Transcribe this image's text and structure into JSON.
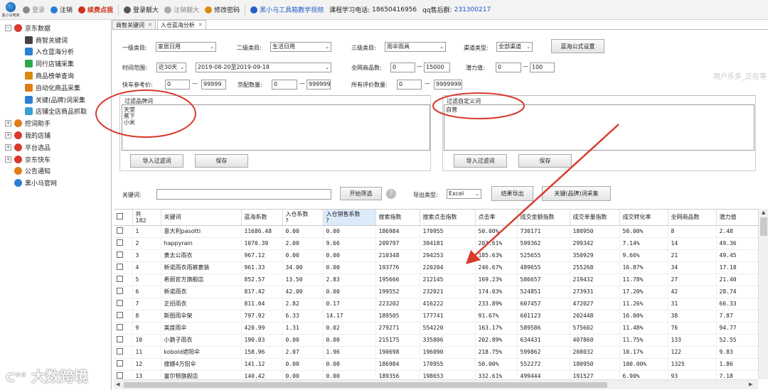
{
  "toolbar": {
    "logo_caption": "黑小马电商",
    "items": [
      {
        "label": "登录",
        "icon": "user-icon",
        "color": "#8a8a8a",
        "dim": true
      },
      {
        "label": "注销",
        "icon": "power-icon",
        "color": "#2a7fd4"
      },
      {
        "label": "续费点我",
        "icon": "ribbon-icon",
        "color": "#d0301a",
        "red": true
      },
      {
        "label": "登录靓大",
        "icon": "login-icon",
        "color": "#555"
      },
      {
        "label": "注销靓大",
        "icon": "power-icon",
        "color": "#aaa",
        "dim": true
      },
      {
        "label": "修改密码",
        "icon": "key-icon",
        "color": "#e08a10"
      },
      {
        "label": "黑小马工具箱教学视频",
        "icon": "video-icon",
        "color": "#2460c8",
        "blue": true
      }
    ],
    "phone_label": "课程学习电话:",
    "phone": "18650416956",
    "qq_label": "qq售后群:",
    "qq": "231300217"
  },
  "sidebar": {
    "items": [
      {
        "label": "京东数据",
        "expanded": true,
        "color": "#d8392b"
      },
      {
        "label": "商智关键词",
        "child": true,
        "color": "#444"
      },
      {
        "label": "入仓蓝海分析",
        "child": true,
        "color": "#2a7fd4"
      },
      {
        "label": "同行店铺采集",
        "child": true,
        "color": "#2da84a"
      },
      {
        "label": "商品榜单查询",
        "child": true,
        "color": "#d88a10"
      },
      {
        "label": "自动化商品采集",
        "child": true,
        "color": "#e07b1a"
      },
      {
        "label": "关键(品牌)词采集",
        "child": true,
        "color": "#2a7fd4"
      },
      {
        "label": "店铺全店商品抓取",
        "child": true,
        "color": "#3aa0d8"
      },
      {
        "label": "挖词助手",
        "expanded": false,
        "color": "#e07b1a"
      },
      {
        "label": "我的店铺",
        "expanded": false,
        "color": "#d8392b"
      },
      {
        "label": "平台选品",
        "expanded": false,
        "color": "#d8392b"
      },
      {
        "label": "京东快车",
        "expanded": false,
        "color": "#d8392b"
      },
      {
        "label": "公告通知",
        "color": "#e07b1a"
      },
      {
        "label": "黑小马官网",
        "color": "#2a7fd4"
      }
    ]
  },
  "tabs": [
    {
      "label": "商智关键词",
      "active": false
    },
    {
      "label": "入仓蓝海分析",
      "active": true
    }
  ],
  "filters": {
    "cat1_label": "一级类目:",
    "cat1": "家居日用",
    "cat2_label": "二级类目:",
    "cat2": "生活日用",
    "cat3_label": "三级类目:",
    "cat3": "雨伞雨具",
    "channel_label": "渠道类型:",
    "channel": "全部渠道",
    "formula_btn": "蓝海公式设置",
    "time_label": "时间范围:",
    "time_preset": "近30天",
    "time_range": "2019-08-20至2019-09-18",
    "total_label": "全网商品数:",
    "total_min": "0",
    "total_max": "15000",
    "potential_label": "潜力值:",
    "potential_min": "0",
    "potential_max": "100",
    "price_label": "快车参考价:",
    "price_min": "0",
    "price_max": "99999",
    "jd_label": "京配数量:",
    "jd_min": "0",
    "jd_max": "999999",
    "review_label": "所有评价数量:",
    "review_min": "0",
    "review_max": "9999999",
    "dash": "—",
    "ghost_text": "用户乐多_正在等"
  },
  "brand_filter": {
    "title": "过滤品牌词",
    "lines": [
      "天堂",
      "蕉下",
      "小米"
    ],
    "import_btn": "导入过滤词",
    "save_btn": "保存"
  },
  "custom_filter": {
    "title": "过滤自定义词",
    "lines": [
      "自营"
    ],
    "import_btn": "导入过滤词",
    "save_btn": "保存"
  },
  "search": {
    "keyword_label": "关键词:",
    "keyword_value": "",
    "start_btn": "开始筛选",
    "help": "?",
    "export_label": "导出类型:",
    "export_type": "Excel",
    "export_btn": "结果导出",
    "collect_btn": "关键(品牌)词采集"
  },
  "table": {
    "headers": [
      "共\n182",
      "关键词",
      "蓝海系数",
      "入仓系数\n?",
      "入仓销售系数\n?",
      "搜索指数",
      "搜索点击指数",
      "点击率",
      "成交金额指数",
      "成交单量指数",
      "成交转化率",
      "全网商品数",
      "潜力值"
    ],
    "rows": [
      [
        "1",
        "意大利pasotti",
        "11686.48",
        "0.00",
        "0.00",
        "186984",
        "170955",
        "50.00%",
        "730171",
        "180950",
        "50.00%",
        "8",
        "2.48"
      ],
      [
        "2",
        "happyrain",
        "1070.39",
        "2.00",
        "9.66",
        "209797",
        "304181",
        "203.61%",
        "599362",
        "299342",
        "7.14%",
        "14",
        "49.36"
      ],
      [
        "3",
        "黄太公雨衣",
        "967.12",
        "0.00",
        "0.00",
        "210348",
        "294253",
        "185.63%",
        "525655",
        "350929",
        "9.66%",
        "21",
        "49.45"
      ],
      [
        "4",
        "新诺雨衣雨裤套装",
        "961.33",
        "34.00",
        "0.00",
        "193776",
        "220204",
        "246.67%",
        "489655",
        "255268",
        "16.87%",
        "34",
        "17.18"
      ],
      [
        "5",
        "希丽官方旗舰店",
        "852.57",
        "13.50",
        "2.83",
        "195666",
        "212145",
        "169.23%",
        "586657",
        "219432",
        "11.78%",
        "27",
        "21.40"
      ],
      [
        "6",
        "新诺雨衣",
        "817.42",
        "42.00",
        "0.00",
        "199552",
        "232021",
        "174.03%",
        "524851",
        "273931",
        "17.20%",
        "42",
        "28.74"
      ],
      [
        "7",
        "正招雨衣",
        "811.04",
        "2.82",
        "0.17",
        "223202",
        "416222",
        "233.89%",
        "607457",
        "472027",
        "11.26%",
        "31",
        "66.33"
      ],
      [
        "8",
        "斯图雨伞架",
        "797.92",
        "6.33",
        "14.17",
        "189505",
        "177741",
        "91.67%",
        "601123",
        "202448",
        "16.00%",
        "38",
        "7.87"
      ],
      [
        "9",
        "美度雨伞",
        "420.99",
        "1.31",
        "0.02",
        "279271",
        "554220",
        "163.17%",
        "589586",
        "575602",
        "11.48%",
        "76",
        "94.77"
      ],
      [
        "10",
        "小鹅子雨衣",
        "190.03",
        "0.00",
        "0.00",
        "215175",
        "335806",
        "202.89%",
        "634431",
        "407860",
        "11.75%",
        "133",
        "52.55"
      ],
      [
        "11",
        "kobold遮阳伞",
        "158.96",
        "2.07",
        "1.96",
        "190698",
        "196090",
        "218.75%",
        "599862",
        "208032",
        "10.17%",
        "122",
        "9.83"
      ],
      [
        "12",
        "搜娜4万铝伞",
        "141.12",
        "0.00",
        "0.00",
        "186984",
        "170955",
        "50.00%",
        "552272",
        "180950",
        "100.00%",
        "1325",
        "1.86"
      ],
      [
        "13",
        "富尔顿旗舰店",
        "140.42",
        "0.00",
        "0.00",
        "189356",
        "198653",
        "332.61%",
        "499444",
        "191527",
        "6.90%",
        "93",
        "7.18"
      ]
    ]
  },
  "watermark": "大数跨境",
  "colors": {
    "annotation": "#d83a2e",
    "header_highlight": "#dcebfa",
    "link_blue": "#2460c8"
  }
}
